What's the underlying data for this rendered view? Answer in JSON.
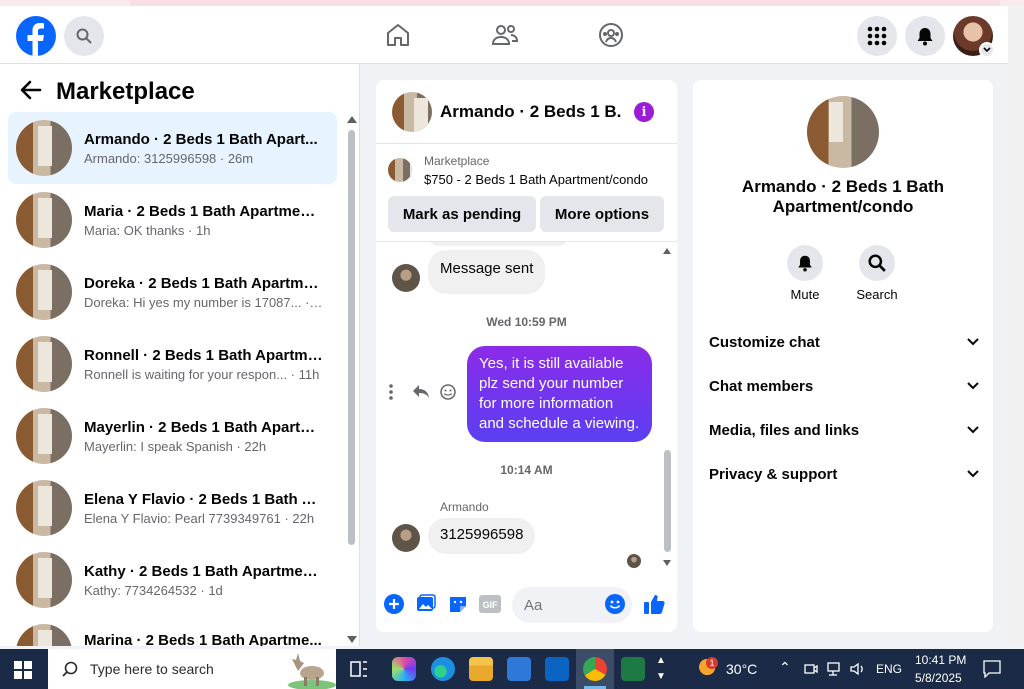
{
  "header": {
    "search_icon": "search-icon",
    "nav_icons": [
      "home-icon",
      "friends-icon",
      "groups-icon"
    ],
    "apps_icon": "menu-grid-icon",
    "notifications_icon": "bell-icon"
  },
  "left": {
    "title": "Marketplace",
    "conversations": [
      {
        "name": "Armando · 2 Beds 1 Bath Apart...",
        "preview": "Armando: 3125996598 · 26m",
        "active": true
      },
      {
        "name": "Maria · 2 Beds 1 Bath Apartment...",
        "preview": "Maria: OK thanks · 1h"
      },
      {
        "name": "Doreka · 2 Beds 1 Bath Apartme...",
        "preview": "Doreka: Hi yes my number is 17087... · 4h"
      },
      {
        "name": "Ronnell · 2 Beds 1 Bath Apartme...",
        "preview": "Ronnell is waiting for your respon... · 11h"
      },
      {
        "name": "Mayerlin · 2 Beds 1 Bath Apartme...",
        "preview": "Mayerlin: I speak Spanish · 22h"
      },
      {
        "name": "Elena Y Flavio · 2 Beds 1 Bath Ap...",
        "preview": "Elena Y Flavio: Pearl 7739349761 · 22h"
      },
      {
        "name": "Kathy · 2 Beds 1 Bath Apartment...",
        "preview": "Kathy: 7734264532 · 1d"
      },
      {
        "name": "Marina · 2 Beds 1 Bath Apartme...",
        "preview": ""
      }
    ]
  },
  "chat": {
    "title": "Armando · 2 Beds 1 B...",
    "listing_source": "Marketplace",
    "listing_price": "$750 - 2 Beds 1 Bath Apartment/condo",
    "mark_pending": "Mark as pending",
    "more_options": "More options",
    "msg_sent": "Message sent",
    "time1": "Wed 10:59 PM",
    "outgoing": "Yes, it is still available plz send your number for more information and schedule a viewing.",
    "time2": "10:14 AM",
    "sender": "Armando",
    "incoming": "3125996598",
    "input_placeholder": "Aa"
  },
  "right": {
    "title": "Armando · 2 Beds 1 Bath Apartment/condo",
    "mute": "Mute",
    "search": "Search",
    "sections": [
      "Customize chat",
      "Chat members",
      "Media, files and links",
      "Privacy & support"
    ]
  },
  "taskbar": {
    "search_placeholder": "Type here to search",
    "weather": "30°C",
    "weather_badge": "1",
    "lang": "ENG",
    "time": "10:41 PM",
    "date": "5/8/2025"
  },
  "colors": {
    "brand": "#0866ff",
    "bubble_out": "#7b35ee",
    "info": "#9b1bd6"
  }
}
